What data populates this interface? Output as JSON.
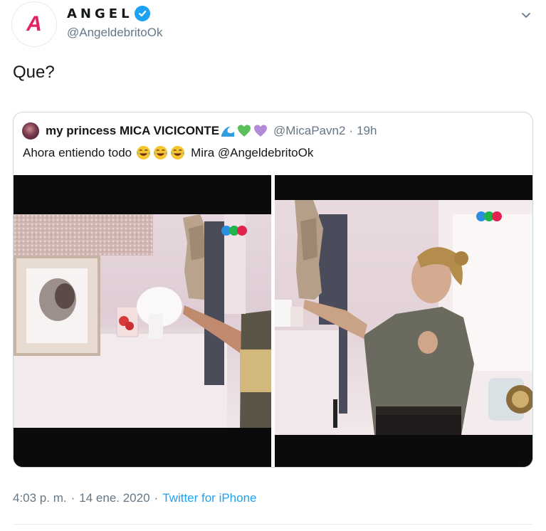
{
  "author": {
    "avatar_letter": "A",
    "display_name": "ANGEL",
    "handle": "@AngeldebritoOk",
    "verified": true
  },
  "tweet": {
    "text": "Que?"
  },
  "quoted_tweet": {
    "display_name": "my princess MICA VICICONTE",
    "name_emojis": [
      "wave-icon",
      "green-heart-icon",
      "purple-heart-icon"
    ],
    "handle": "@MicaPavn2",
    "separator": "·",
    "time": "19h",
    "text_before": "Ahora entiendo todo",
    "laugh_emojis": [
      "tears-of-joy-icon",
      "tears-of-joy-icon",
      "tears-of-joy-icon"
    ],
    "text_after": "Mira @AngeldebritoOk",
    "media": [
      {
        "description_icon": "video-frame-left",
        "logo": "telefe-logo-icon"
      },
      {
        "description_icon": "video-frame-right",
        "logo": "telefe-logo-icon"
      }
    ]
  },
  "meta": {
    "time": "4:03 p. m.",
    "separator": "·",
    "date": "14 ene. 2020",
    "source": "Twitter for iPhone"
  },
  "colors": {
    "accent": "#1da1f2",
    "secondary_text": "#657786",
    "logo_red": "#e0245e",
    "telefe_blue": "#2a8fe0",
    "telefe_green": "#22b34a",
    "telefe_red": "#e2234f"
  }
}
